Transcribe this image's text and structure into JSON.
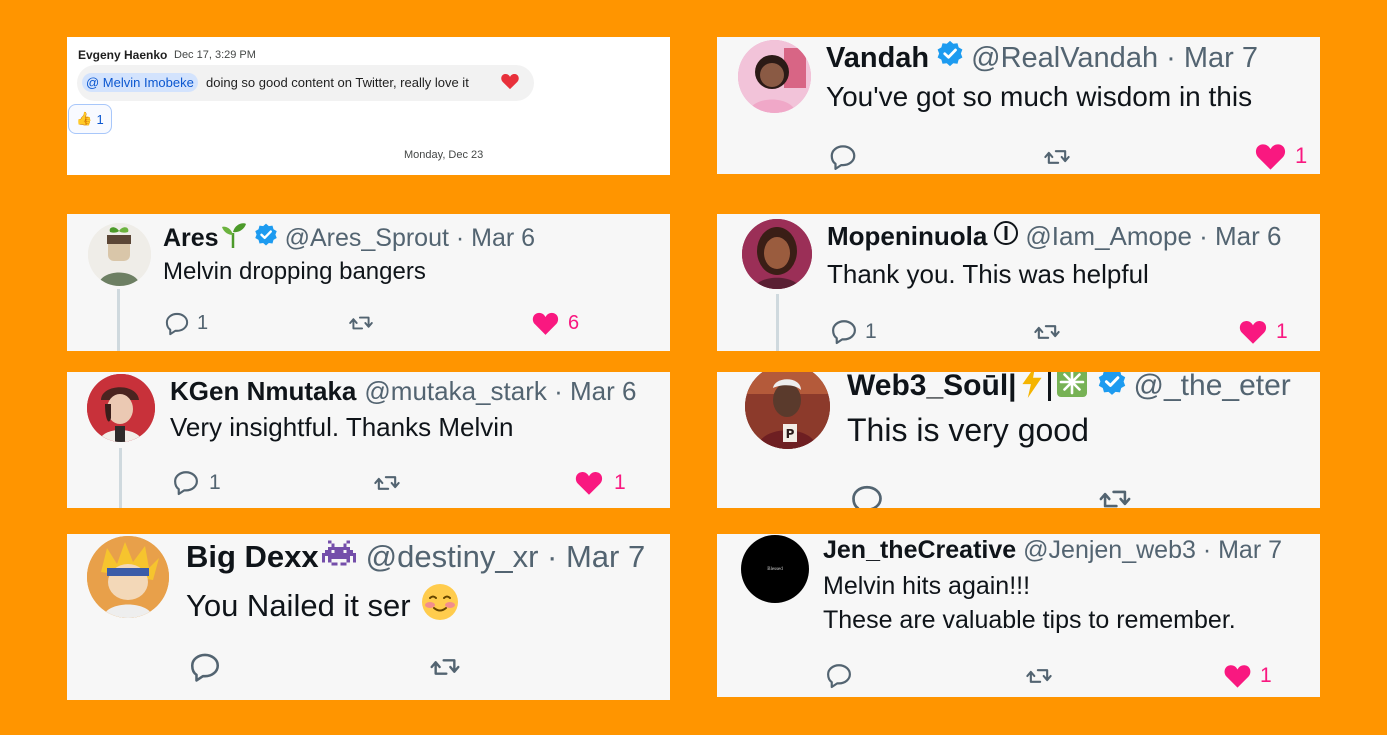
{
  "chat": {
    "sender": "Evgeny Haenko",
    "time": "Dec 17, 3:29 PM",
    "mention": "@ Melvin Imobeke",
    "message": "doing so good content on Twitter, really love it",
    "reaction_emoji": "👍",
    "reaction_count": "1",
    "date_separator": "Monday, Dec 23"
  },
  "tweets": {
    "vandah": {
      "name": "Vandah",
      "handle": "@RealVandah · Mar 7",
      "text": "You've got so much wisdom in this",
      "like_count": "1"
    },
    "ares": {
      "name": "Ares",
      "handle": "@Ares_Sprout · Mar 6",
      "text": "Melvin dropping bangers",
      "reply_count": "1",
      "like_count": "6"
    },
    "mope": {
      "name": "Mopeninuola",
      "handle": "@Iam_Amope · Mar 6",
      "text": "Thank you. This was helpful",
      "reply_count": "1",
      "like_count": "1"
    },
    "kgen": {
      "name": "KGen Nmutaka",
      "handle": "@mutaka_stark · Mar 6",
      "text": "Very insightful. Thanks Melvin",
      "reply_count": "1",
      "like_count": "1"
    },
    "web3": {
      "name": "Web3_Soūl|",
      "handle": "@_the_eter",
      "text": "This is very good"
    },
    "dexx": {
      "name": "Big Dexx",
      "handle": "@destiny_xr · Mar 7",
      "text": "You Nailed it ser",
      "emoji": "☺"
    },
    "jen": {
      "name": "Jen_theCreative",
      "handle": "@Jenjen_web3 · Mar 7",
      "text_line1": "Melvin hits again!!!",
      "text_line2": "These are valuable tips to remember.",
      "like_count": "1",
      "avatar_text": "Blessed"
    }
  },
  "colors": {
    "background": "#FF9500",
    "like": "#F91880",
    "verified": "#1D9BF0",
    "text": "#0F1419",
    "muted": "#536471"
  }
}
